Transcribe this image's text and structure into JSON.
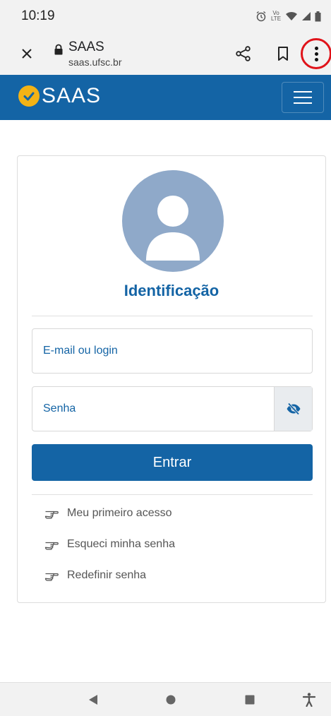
{
  "status_bar": {
    "time": "10:19",
    "icons": [
      "alarm-icon",
      "volte-icon",
      "wifi-icon",
      "signal-icon",
      "battery-icon"
    ],
    "volte_label": "Vo LTE"
  },
  "browser": {
    "title": "SAAS",
    "url": "saas.ufsc.br",
    "icons": [
      "close-icon",
      "lock-icon",
      "share-icon",
      "bookmark-icon",
      "more-vert-icon"
    ],
    "highlight_color": "#e0131a"
  },
  "site": {
    "logo_text": "SAAS",
    "brand_color": "#1464a5",
    "logo_accent": "#f4b315"
  },
  "login": {
    "title": "Identificação",
    "email_placeholder": "E-mail ou login",
    "password_placeholder": "Senha",
    "submit_label": "Entrar",
    "links": [
      {
        "label": "Meu primeiro acesso",
        "icon": "pointing-hand-icon"
      },
      {
        "label": "Esqueci minha senha",
        "icon": "pointing-hand-icon"
      },
      {
        "label": "Redefinir senha",
        "icon": "pointing-hand-icon"
      }
    ]
  },
  "nav_bar": {
    "icons": [
      "back-icon",
      "home-icon",
      "recents-icon",
      "accessibility-icon"
    ]
  }
}
